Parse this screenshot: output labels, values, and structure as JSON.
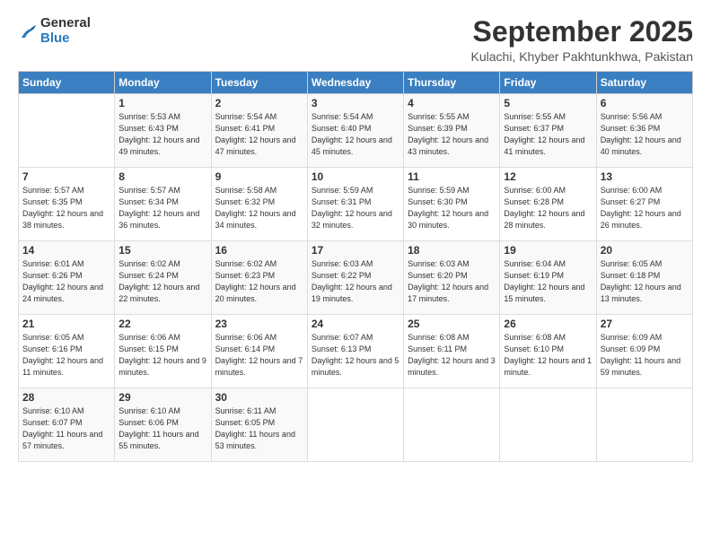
{
  "logo": {
    "general": "General",
    "blue": "Blue"
  },
  "title": "September 2025",
  "location": "Kulachi, Khyber Pakhtunkhwa, Pakistan",
  "days_of_week": [
    "Sunday",
    "Monday",
    "Tuesday",
    "Wednesday",
    "Thursday",
    "Friday",
    "Saturday"
  ],
  "weeks": [
    [
      {
        "day": "",
        "sunrise": "",
        "sunset": "",
        "daylight": ""
      },
      {
        "day": "1",
        "sunrise": "Sunrise: 5:53 AM",
        "sunset": "Sunset: 6:43 PM",
        "daylight": "Daylight: 12 hours and 49 minutes."
      },
      {
        "day": "2",
        "sunrise": "Sunrise: 5:54 AM",
        "sunset": "Sunset: 6:41 PM",
        "daylight": "Daylight: 12 hours and 47 minutes."
      },
      {
        "day": "3",
        "sunrise": "Sunrise: 5:54 AM",
        "sunset": "Sunset: 6:40 PM",
        "daylight": "Daylight: 12 hours and 45 minutes."
      },
      {
        "day": "4",
        "sunrise": "Sunrise: 5:55 AM",
        "sunset": "Sunset: 6:39 PM",
        "daylight": "Daylight: 12 hours and 43 minutes."
      },
      {
        "day": "5",
        "sunrise": "Sunrise: 5:55 AM",
        "sunset": "Sunset: 6:37 PM",
        "daylight": "Daylight: 12 hours and 41 minutes."
      },
      {
        "day": "6",
        "sunrise": "Sunrise: 5:56 AM",
        "sunset": "Sunset: 6:36 PM",
        "daylight": "Daylight: 12 hours and 40 minutes."
      }
    ],
    [
      {
        "day": "7",
        "sunrise": "Sunrise: 5:57 AM",
        "sunset": "Sunset: 6:35 PM",
        "daylight": "Daylight: 12 hours and 38 minutes."
      },
      {
        "day": "8",
        "sunrise": "Sunrise: 5:57 AM",
        "sunset": "Sunset: 6:34 PM",
        "daylight": "Daylight: 12 hours and 36 minutes."
      },
      {
        "day": "9",
        "sunrise": "Sunrise: 5:58 AM",
        "sunset": "Sunset: 6:32 PM",
        "daylight": "Daylight: 12 hours and 34 minutes."
      },
      {
        "day": "10",
        "sunrise": "Sunrise: 5:59 AM",
        "sunset": "Sunset: 6:31 PM",
        "daylight": "Daylight: 12 hours and 32 minutes."
      },
      {
        "day": "11",
        "sunrise": "Sunrise: 5:59 AM",
        "sunset": "Sunset: 6:30 PM",
        "daylight": "Daylight: 12 hours and 30 minutes."
      },
      {
        "day": "12",
        "sunrise": "Sunrise: 6:00 AM",
        "sunset": "Sunset: 6:28 PM",
        "daylight": "Daylight: 12 hours and 28 minutes."
      },
      {
        "day": "13",
        "sunrise": "Sunrise: 6:00 AM",
        "sunset": "Sunset: 6:27 PM",
        "daylight": "Daylight: 12 hours and 26 minutes."
      }
    ],
    [
      {
        "day": "14",
        "sunrise": "Sunrise: 6:01 AM",
        "sunset": "Sunset: 6:26 PM",
        "daylight": "Daylight: 12 hours and 24 minutes."
      },
      {
        "day": "15",
        "sunrise": "Sunrise: 6:02 AM",
        "sunset": "Sunset: 6:24 PM",
        "daylight": "Daylight: 12 hours and 22 minutes."
      },
      {
        "day": "16",
        "sunrise": "Sunrise: 6:02 AM",
        "sunset": "Sunset: 6:23 PM",
        "daylight": "Daylight: 12 hours and 20 minutes."
      },
      {
        "day": "17",
        "sunrise": "Sunrise: 6:03 AM",
        "sunset": "Sunset: 6:22 PM",
        "daylight": "Daylight: 12 hours and 19 minutes."
      },
      {
        "day": "18",
        "sunrise": "Sunrise: 6:03 AM",
        "sunset": "Sunset: 6:20 PM",
        "daylight": "Daylight: 12 hours and 17 minutes."
      },
      {
        "day": "19",
        "sunrise": "Sunrise: 6:04 AM",
        "sunset": "Sunset: 6:19 PM",
        "daylight": "Daylight: 12 hours and 15 minutes."
      },
      {
        "day": "20",
        "sunrise": "Sunrise: 6:05 AM",
        "sunset": "Sunset: 6:18 PM",
        "daylight": "Daylight: 12 hours and 13 minutes."
      }
    ],
    [
      {
        "day": "21",
        "sunrise": "Sunrise: 6:05 AM",
        "sunset": "Sunset: 6:16 PM",
        "daylight": "Daylight: 12 hours and 11 minutes."
      },
      {
        "day": "22",
        "sunrise": "Sunrise: 6:06 AM",
        "sunset": "Sunset: 6:15 PM",
        "daylight": "Daylight: 12 hours and 9 minutes."
      },
      {
        "day": "23",
        "sunrise": "Sunrise: 6:06 AM",
        "sunset": "Sunset: 6:14 PM",
        "daylight": "Daylight: 12 hours and 7 minutes."
      },
      {
        "day": "24",
        "sunrise": "Sunrise: 6:07 AM",
        "sunset": "Sunset: 6:13 PM",
        "daylight": "Daylight: 12 hours and 5 minutes."
      },
      {
        "day": "25",
        "sunrise": "Sunrise: 6:08 AM",
        "sunset": "Sunset: 6:11 PM",
        "daylight": "Daylight: 12 hours and 3 minutes."
      },
      {
        "day": "26",
        "sunrise": "Sunrise: 6:08 AM",
        "sunset": "Sunset: 6:10 PM",
        "daylight": "Daylight: 12 hours and 1 minute."
      },
      {
        "day": "27",
        "sunrise": "Sunrise: 6:09 AM",
        "sunset": "Sunset: 6:09 PM",
        "daylight": "Daylight: 11 hours and 59 minutes."
      }
    ],
    [
      {
        "day": "28",
        "sunrise": "Sunrise: 6:10 AM",
        "sunset": "Sunset: 6:07 PM",
        "daylight": "Daylight: 11 hours and 57 minutes."
      },
      {
        "day": "29",
        "sunrise": "Sunrise: 6:10 AM",
        "sunset": "Sunset: 6:06 PM",
        "daylight": "Daylight: 11 hours and 55 minutes."
      },
      {
        "day": "30",
        "sunrise": "Sunrise: 6:11 AM",
        "sunset": "Sunset: 6:05 PM",
        "daylight": "Daylight: 11 hours and 53 minutes."
      },
      {
        "day": "",
        "sunrise": "",
        "sunset": "",
        "daylight": ""
      },
      {
        "day": "",
        "sunrise": "",
        "sunset": "",
        "daylight": ""
      },
      {
        "day": "",
        "sunrise": "",
        "sunset": "",
        "daylight": ""
      },
      {
        "day": "",
        "sunrise": "",
        "sunset": "",
        "daylight": ""
      }
    ]
  ]
}
